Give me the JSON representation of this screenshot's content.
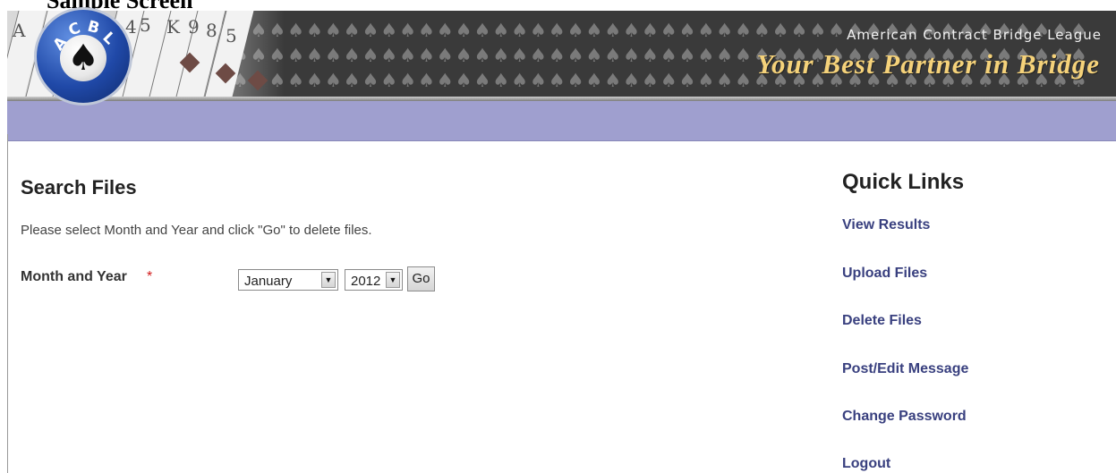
{
  "document": {
    "caption": "Sample Screen"
  },
  "header": {
    "org_name": "American Contract Bridge League",
    "tagline": "Your Best Partner in Bridge",
    "logo_letters": [
      "A",
      "C",
      "B",
      "L"
    ],
    "logo_icon": "spade-icon",
    "card_marks": [
      "A",
      "4",
      "5",
      "K",
      "9",
      "8",
      "5"
    ],
    "colors": {
      "nav_bar": "#9f9fcf",
      "tagline": "#f5d27a",
      "link": "#39407f",
      "required": "#d21a1a"
    }
  },
  "search": {
    "title": "Search Files",
    "instructions": "Please select Month and Year and click \"Go\" to delete files.",
    "month_year_label": "Month and Year",
    "required_mark": "*",
    "month_value": "January",
    "year_value": "2012",
    "dropdown_icon": "dropdown-arrow-icon",
    "go_label": "Go"
  },
  "quick_links": {
    "title": "Quick Links",
    "items": [
      {
        "label": "View Results"
      },
      {
        "label": "Upload Files"
      },
      {
        "label": "Delete Files"
      },
      {
        "label": "Post/Edit Message"
      },
      {
        "label": "Change Password"
      },
      {
        "label": "Logout"
      }
    ]
  }
}
